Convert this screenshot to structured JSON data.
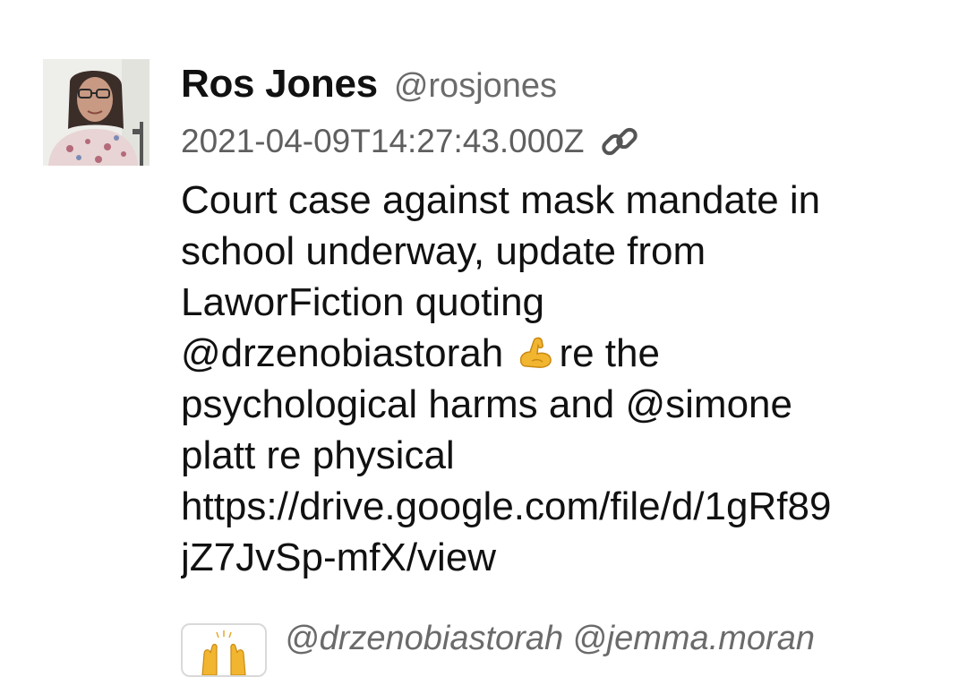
{
  "post": {
    "author": {
      "display_name": "Ros Jones",
      "handle": "@rosjones"
    },
    "timestamp": "2021-04-09T14:27:43.000Z",
    "permalink_icon": "link-icon",
    "body_lines": [
      "Court case against mask mandate in",
      "school underway, update from",
      "LaworFiction quoting",
      "@drzenobiastorah",
      "re the",
      "psychological harms and @simone",
      "platt re physical",
      "https://drive.google.com/file/d/1gRf89",
      "jZ7JvSp-mfX/view"
    ],
    "emoji": "flexed-biceps-icon"
  },
  "reply": {
    "mentions": [
      "@drzenobiastorah",
      "@jemma.moran"
    ],
    "avatar_icon": "raising-hands-icon"
  },
  "colors": {
    "text": "#111111",
    "muted": "#6b6b6b",
    "timestamp": "#5f5f5f"
  }
}
